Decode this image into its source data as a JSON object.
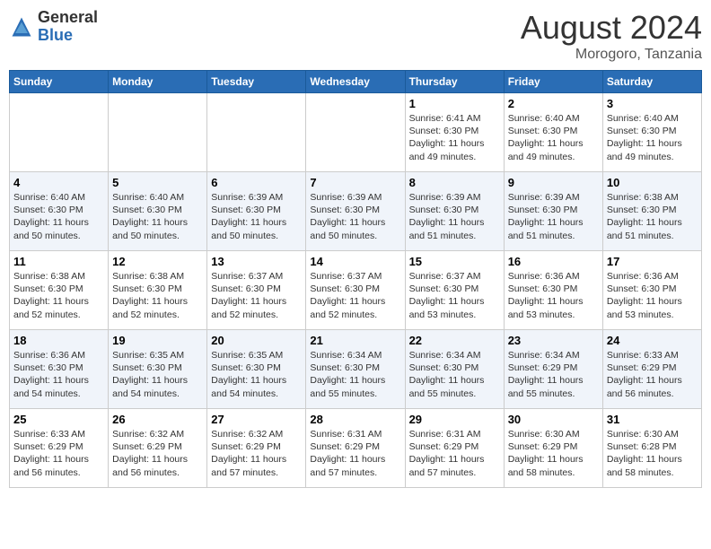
{
  "header": {
    "logo_general": "General",
    "logo_blue": "Blue",
    "month": "August 2024",
    "location": "Morogoro, Tanzania"
  },
  "weekdays": [
    "Sunday",
    "Monday",
    "Tuesday",
    "Wednesday",
    "Thursday",
    "Friday",
    "Saturday"
  ],
  "weeks": [
    [
      {
        "day": "",
        "info": ""
      },
      {
        "day": "",
        "info": ""
      },
      {
        "day": "",
        "info": ""
      },
      {
        "day": "",
        "info": ""
      },
      {
        "day": "1",
        "info": "Sunrise: 6:41 AM\nSunset: 6:30 PM\nDaylight: 11 hours\nand 49 minutes."
      },
      {
        "day": "2",
        "info": "Sunrise: 6:40 AM\nSunset: 6:30 PM\nDaylight: 11 hours\nand 49 minutes."
      },
      {
        "day": "3",
        "info": "Sunrise: 6:40 AM\nSunset: 6:30 PM\nDaylight: 11 hours\nand 49 minutes."
      }
    ],
    [
      {
        "day": "4",
        "info": "Sunrise: 6:40 AM\nSunset: 6:30 PM\nDaylight: 11 hours\nand 50 minutes."
      },
      {
        "day": "5",
        "info": "Sunrise: 6:40 AM\nSunset: 6:30 PM\nDaylight: 11 hours\nand 50 minutes."
      },
      {
        "day": "6",
        "info": "Sunrise: 6:39 AM\nSunset: 6:30 PM\nDaylight: 11 hours\nand 50 minutes."
      },
      {
        "day": "7",
        "info": "Sunrise: 6:39 AM\nSunset: 6:30 PM\nDaylight: 11 hours\nand 50 minutes."
      },
      {
        "day": "8",
        "info": "Sunrise: 6:39 AM\nSunset: 6:30 PM\nDaylight: 11 hours\nand 51 minutes."
      },
      {
        "day": "9",
        "info": "Sunrise: 6:39 AM\nSunset: 6:30 PM\nDaylight: 11 hours\nand 51 minutes."
      },
      {
        "day": "10",
        "info": "Sunrise: 6:38 AM\nSunset: 6:30 PM\nDaylight: 11 hours\nand 51 minutes."
      }
    ],
    [
      {
        "day": "11",
        "info": "Sunrise: 6:38 AM\nSunset: 6:30 PM\nDaylight: 11 hours\nand 52 minutes."
      },
      {
        "day": "12",
        "info": "Sunrise: 6:38 AM\nSunset: 6:30 PM\nDaylight: 11 hours\nand 52 minutes."
      },
      {
        "day": "13",
        "info": "Sunrise: 6:37 AM\nSunset: 6:30 PM\nDaylight: 11 hours\nand 52 minutes."
      },
      {
        "day": "14",
        "info": "Sunrise: 6:37 AM\nSunset: 6:30 PM\nDaylight: 11 hours\nand 52 minutes."
      },
      {
        "day": "15",
        "info": "Sunrise: 6:37 AM\nSunset: 6:30 PM\nDaylight: 11 hours\nand 53 minutes."
      },
      {
        "day": "16",
        "info": "Sunrise: 6:36 AM\nSunset: 6:30 PM\nDaylight: 11 hours\nand 53 minutes."
      },
      {
        "day": "17",
        "info": "Sunrise: 6:36 AM\nSunset: 6:30 PM\nDaylight: 11 hours\nand 53 minutes."
      }
    ],
    [
      {
        "day": "18",
        "info": "Sunrise: 6:36 AM\nSunset: 6:30 PM\nDaylight: 11 hours\nand 54 minutes."
      },
      {
        "day": "19",
        "info": "Sunrise: 6:35 AM\nSunset: 6:30 PM\nDaylight: 11 hours\nand 54 minutes."
      },
      {
        "day": "20",
        "info": "Sunrise: 6:35 AM\nSunset: 6:30 PM\nDaylight: 11 hours\nand 54 minutes."
      },
      {
        "day": "21",
        "info": "Sunrise: 6:34 AM\nSunset: 6:30 PM\nDaylight: 11 hours\nand 55 minutes."
      },
      {
        "day": "22",
        "info": "Sunrise: 6:34 AM\nSunset: 6:30 PM\nDaylight: 11 hours\nand 55 minutes."
      },
      {
        "day": "23",
        "info": "Sunrise: 6:34 AM\nSunset: 6:29 PM\nDaylight: 11 hours\nand 55 minutes."
      },
      {
        "day": "24",
        "info": "Sunrise: 6:33 AM\nSunset: 6:29 PM\nDaylight: 11 hours\nand 56 minutes."
      }
    ],
    [
      {
        "day": "25",
        "info": "Sunrise: 6:33 AM\nSunset: 6:29 PM\nDaylight: 11 hours\nand 56 minutes."
      },
      {
        "day": "26",
        "info": "Sunrise: 6:32 AM\nSunset: 6:29 PM\nDaylight: 11 hours\nand 56 minutes."
      },
      {
        "day": "27",
        "info": "Sunrise: 6:32 AM\nSunset: 6:29 PM\nDaylight: 11 hours\nand 57 minutes."
      },
      {
        "day": "28",
        "info": "Sunrise: 6:31 AM\nSunset: 6:29 PM\nDaylight: 11 hours\nand 57 minutes."
      },
      {
        "day": "29",
        "info": "Sunrise: 6:31 AM\nSunset: 6:29 PM\nDaylight: 11 hours\nand 57 minutes."
      },
      {
        "day": "30",
        "info": "Sunrise: 6:30 AM\nSunset: 6:29 PM\nDaylight: 11 hours\nand 58 minutes."
      },
      {
        "day": "31",
        "info": "Sunrise: 6:30 AM\nSunset: 6:28 PM\nDaylight: 11 hours\nand 58 minutes."
      }
    ]
  ]
}
